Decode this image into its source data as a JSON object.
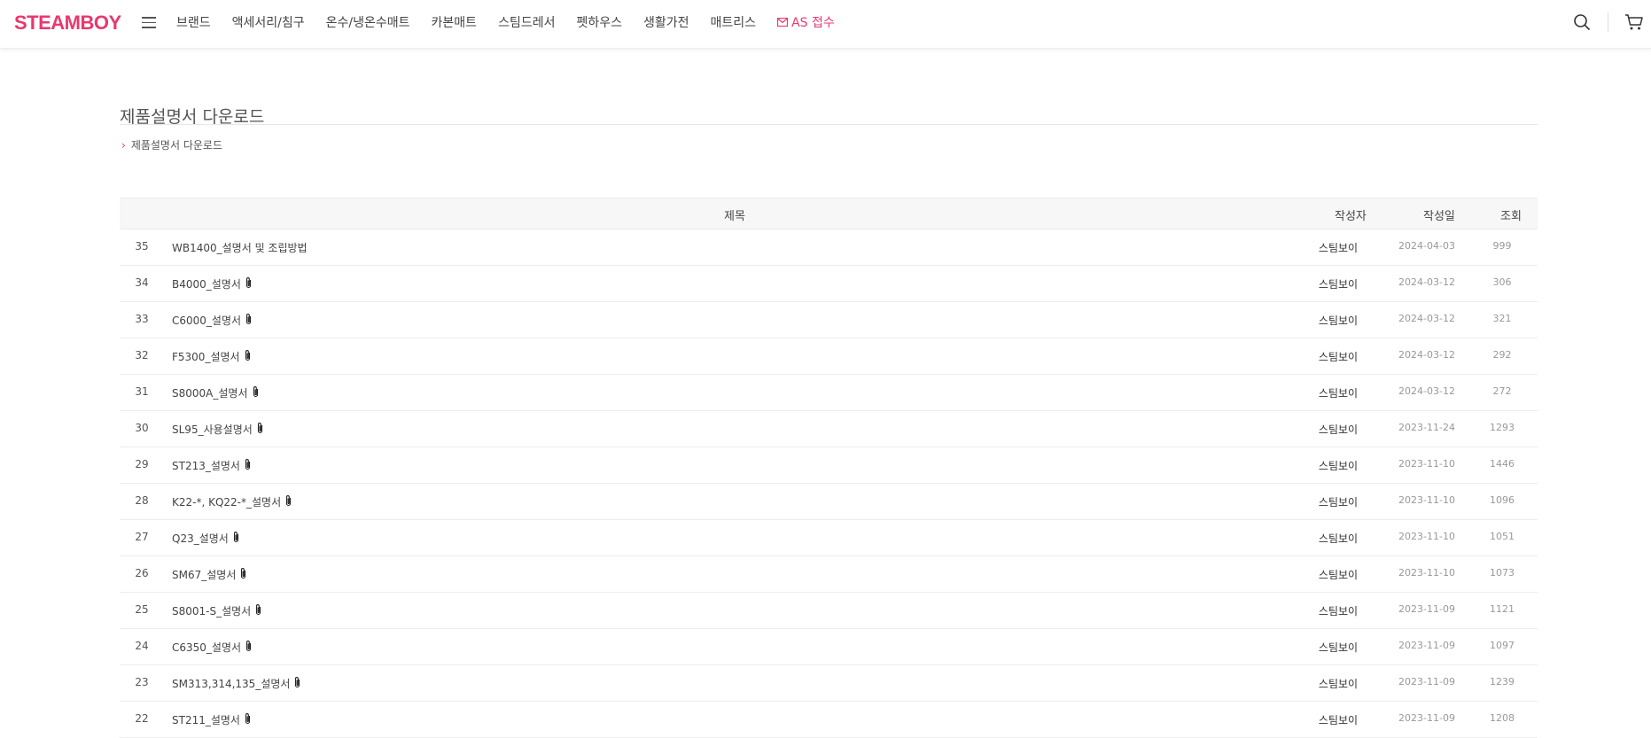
{
  "header": {
    "logo": "STEAMBOY",
    "nav": [
      "브랜드",
      "액세서리/침구",
      "온수/냉온수매트",
      "카본매트",
      "스팀드레서",
      "펫하우스",
      "생활가전",
      "매트리스"
    ],
    "as_label": "AS 접수",
    "accent": "#e8386f"
  },
  "page": {
    "title": "제품설명서 다운로드",
    "breadcrumb": "제품설명서 다운로드"
  },
  "table": {
    "headers": {
      "title": "제목",
      "writer": "작성자",
      "date": "작성일",
      "views": "조회"
    },
    "rows": [
      {
        "no": "35",
        "title": "WB1400_설명서 및 조립방법",
        "attach": false,
        "writer": "스팀보이",
        "date": "2024-04-03",
        "views": "999"
      },
      {
        "no": "34",
        "title": "B4000_설명서",
        "attach": true,
        "writer": "스팀보이",
        "date": "2024-03-12",
        "views": "306"
      },
      {
        "no": "33",
        "title": "C6000_설명서",
        "attach": true,
        "writer": "스팀보이",
        "date": "2024-03-12",
        "views": "321"
      },
      {
        "no": "32",
        "title": "F5300_설명서",
        "attach": true,
        "writer": "스팀보이",
        "date": "2024-03-12",
        "views": "292"
      },
      {
        "no": "31",
        "title": "S8000A_설명서",
        "attach": true,
        "writer": "스팀보이",
        "date": "2024-03-12",
        "views": "272"
      },
      {
        "no": "30",
        "title": "SL95_사용설명서",
        "attach": true,
        "writer": "스팀보이",
        "date": "2023-11-24",
        "views": "1293"
      },
      {
        "no": "29",
        "title": "ST213_설명서",
        "attach": true,
        "writer": "스팀보이",
        "date": "2023-11-10",
        "views": "1446"
      },
      {
        "no": "28",
        "title": "K22-*, KQ22-*_설명서",
        "attach": true,
        "writer": "스팀보이",
        "date": "2023-11-10",
        "views": "1096"
      },
      {
        "no": "27",
        "title": "Q23_설명서",
        "attach": true,
        "writer": "스팀보이",
        "date": "2023-11-10",
        "views": "1051"
      },
      {
        "no": "26",
        "title": "SM67_설명서",
        "attach": true,
        "writer": "스팀보이",
        "date": "2023-11-10",
        "views": "1073"
      },
      {
        "no": "25",
        "title": "S8001-S_설명서",
        "attach": true,
        "writer": "스팀보이",
        "date": "2023-11-09",
        "views": "1121"
      },
      {
        "no": "24",
        "title": "C6350_설명서",
        "attach": true,
        "writer": "스팀보이",
        "date": "2023-11-09",
        "views": "1097"
      },
      {
        "no": "23",
        "title": "SM313,314,135_설명서",
        "attach": true,
        "writer": "스팀보이",
        "date": "2023-11-09",
        "views": "1239"
      },
      {
        "no": "22",
        "title": "ST211_설명서",
        "attach": true,
        "writer": "스팀보이",
        "date": "2023-11-09",
        "views": "1208"
      }
    ]
  }
}
